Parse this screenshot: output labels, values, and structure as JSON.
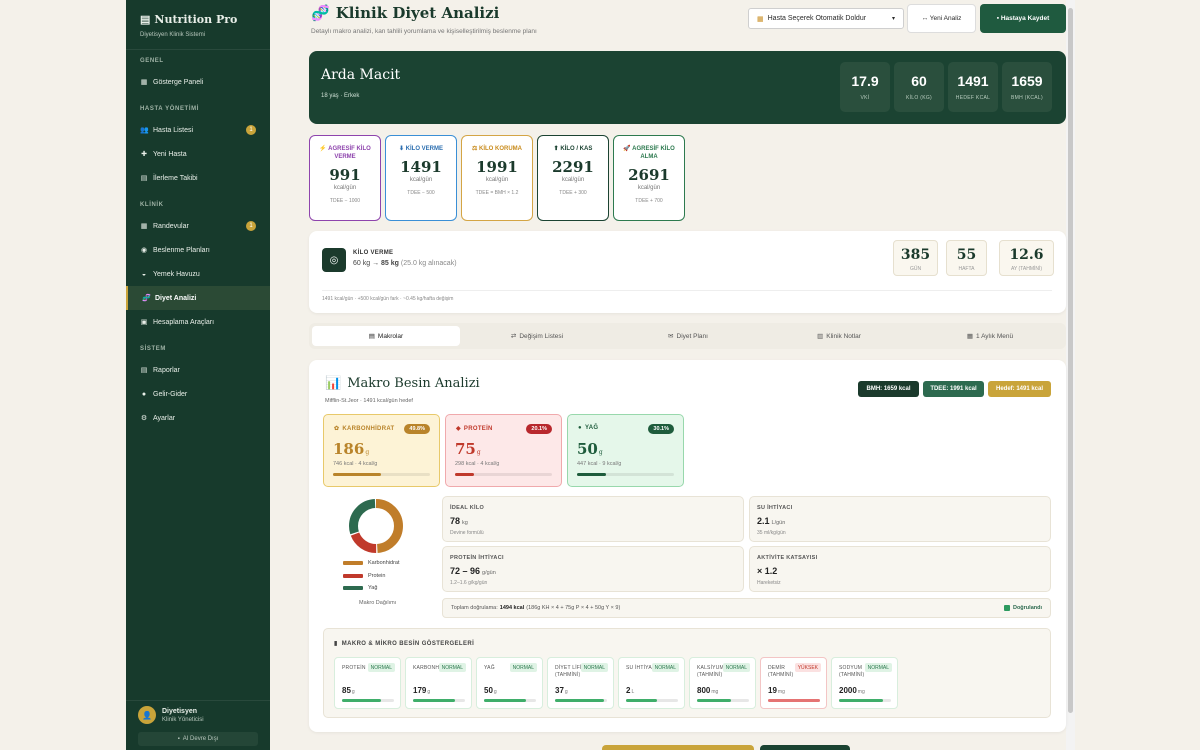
{
  "colors": {
    "sidebar_bg": "#173a2c",
    "accent_gold": "#c9a43a",
    "dark_green": "#1b4332",
    "page_bg": "#f4f1ea"
  },
  "sidebar": {
    "brand": "Nutrition Pro",
    "brand_icon": "document-icon",
    "subtitle": "Diyetisyen Klinik Sistemi",
    "sections": [
      {
        "title": "GENEL",
        "items": [
          {
            "label": "Gösterge Paneli",
            "icon": "dashboard-icon"
          }
        ]
      },
      {
        "title": "HASTA YÖNETİMİ",
        "items": [
          {
            "label": "Hasta Listesi",
            "icon": "users-icon",
            "badge": "1"
          },
          {
            "label": "Yeni Hasta",
            "icon": "plus-icon"
          },
          {
            "label": "İlerleme Takibi",
            "icon": "chart-icon"
          }
        ]
      },
      {
        "title": "KLİNİK",
        "items": [
          {
            "label": "Randevular",
            "icon": "calendar-icon",
            "badge": "1"
          },
          {
            "label": "Beslenme Planları",
            "icon": "plate-icon"
          },
          {
            "label": "Yemek Havuzu",
            "icon": "bowl-icon"
          },
          {
            "label": "Diyet Analizi",
            "icon": "dna-icon",
            "active": true
          },
          {
            "label": "Hesaplama Araçları",
            "icon": "calculator-icon"
          }
        ]
      },
      {
        "title": "SİSTEM",
        "items": [
          {
            "label": "Raporlar",
            "icon": "report-icon"
          },
          {
            "label": "Gelir-Gider",
            "icon": "money-icon"
          },
          {
            "label": "Ayarlar",
            "icon": "gear-icon"
          }
        ]
      }
    ],
    "user": {
      "name": "Diyetisyen",
      "role": "Klinik Yöneticisi"
    },
    "ai_button": "AI Devre Dışı"
  },
  "header": {
    "title": "Klinik Diyet Analizi",
    "subtitle": "Detaylı makro analizi, kan tahlili yorumlama ve kişiselleştirilmiş beslenme planı",
    "select_value": "Hasta Seçerek Otomatik Doldur",
    "new_button": "↔ Yeni Analiz",
    "save_button": "Hastaya Kaydet"
  },
  "patient": {
    "name": "Arda Macit",
    "meta": "18 yaş · Erkek",
    "stats": [
      {
        "value": "17.9",
        "label": "VKİ"
      },
      {
        "value": "60",
        "label": "KİLO (KG)"
      },
      {
        "value": "1491",
        "label": "HEDEF KCAL"
      },
      {
        "value": "1659",
        "label": "BMH (KCAL)"
      }
    ]
  },
  "goals": [
    {
      "name": "AGRESİF KİLO VERME",
      "icon": "lightning-icon",
      "value": "991",
      "unit": "kcal/gün",
      "formula": "TDEE − 1000",
      "color": "#8e44ad",
      "text_color": "#8e44ad"
    },
    {
      "name": "KİLO VERME",
      "icon": "arrow-down-icon",
      "value": "1491",
      "unit": "kcal/gün",
      "formula": "TDEE − 500",
      "color": "#3a8fd6",
      "text_color": "#2d6fb0"
    },
    {
      "name": "KİLO KORUMA",
      "icon": "balance-icon",
      "value": "1991",
      "unit": "kcal/gün",
      "formula": "TDEE = BMH × 1.2",
      "color": "#d4a545",
      "text_color": "#c98c1e"
    },
    {
      "name": "KİLO / KAS",
      "icon": "arrow-up-icon",
      "value": "2291",
      "unit": "kcal/gün",
      "formula": "TDEE + 300",
      "color": "#1b4332",
      "text_color": "#1b4332"
    },
    {
      "name": "AGRESİF KİLO ALMA",
      "icon": "rocket-icon",
      "value": "2691",
      "unit": "kcal/gün",
      "formula": "TDEE + 700",
      "color": "#2d7a4f",
      "text_color": "#2d7a4f"
    }
  ],
  "target": {
    "label": "KİLO VERME",
    "from": "60 kg",
    "arrow": "→",
    "to": "85 kg",
    "note": "(25.0 kg alınacak)",
    "boxes": [
      {
        "value": "385",
        "label": "GÜN"
      },
      {
        "value": "55",
        "label": "HAFTA"
      },
      {
        "value": "12.6",
        "label": "AY (TAHMİNİ)"
      }
    ],
    "footer": "1491 kcal/gün · +500 kcal/gün fark · ~0.45 kg/hafta değişim"
  },
  "tabs": [
    {
      "label": "Makrolar",
      "icon": "chart-icon",
      "active": true
    },
    {
      "label": "Değişim Listesi",
      "icon": "exchange-icon"
    },
    {
      "label": "Diyet Planı",
      "icon": "plan-icon"
    },
    {
      "label": "Klinik Notlar",
      "icon": "notes-icon"
    },
    {
      "label": "1 Aylık Menü",
      "icon": "calendar-icon"
    }
  ],
  "macro": {
    "title": "Makro Besin Analizi",
    "subtitle": "Mifflin-St.Jeor · 1491 kcal/gün hedef",
    "pills": [
      {
        "label": "BMH: 1659 kcal",
        "color": "#1b3a2c"
      },
      {
        "label": "TDEE: 1991 kcal",
        "color": "#2d6a4f"
      },
      {
        "label": "Hedef: 1491 kcal",
        "color": "#c9a43a"
      }
    ],
    "cards": [
      {
        "name": "KARBONHİDRAT",
        "icon": "wheat-icon",
        "pct": "49.8%",
        "value": "186",
        "unit": "g",
        "kcal": "746 kcal · 4 kcal/g",
        "fill": 0.498,
        "border": "#e8c96a",
        "bg": "#fdf3d6",
        "accent": "#b9842a",
        "badge": "#b9842a"
      },
      {
        "name": "PROTEİN",
        "icon": "meat-icon",
        "pct": "20.1%",
        "value": "75",
        "unit": "g",
        "kcal": "298 kcal · 4 kcal/g",
        "fill": 0.201,
        "border": "#f0a9ac",
        "bg": "#fde8e8",
        "accent": "#c0392b",
        "badge": "#b8282d"
      },
      {
        "name": "YAĞ",
        "icon": "olive-icon",
        "pct": "30.1%",
        "value": "50",
        "unit": "g",
        "kcal": "447 kcal · 9 kcal/g",
        "fill": 0.301,
        "border": "#98d8ac",
        "bg": "#e5f7ea",
        "accent": "#1e5c3c",
        "badge": "#1e5c3c"
      }
    ],
    "donut": {
      "caption": "Makro Dağılımı",
      "segments": [
        {
          "name": "Karbonhidrat",
          "value": 49.8,
          "color": "#c07d2a"
        },
        {
          "name": "Protein",
          "value": 20.1,
          "color": "#c0392b"
        },
        {
          "name": "Yağ",
          "value": 30.1,
          "color": "#2d6a4f"
        }
      ]
    },
    "info": [
      {
        "label": "İDEAL KİLO",
        "value": "78",
        "unit": "kg",
        "note": "Devine formülü"
      },
      {
        "label": "SU İHTİYACI",
        "value": "2.1",
        "unit": "L/gün",
        "note": "35 ml/kg/gün"
      },
      {
        "label": "PROTEİN İHTİYACI",
        "value": "72 – 96",
        "unit": "g/gün",
        "note": "1.2–1.6 g/kg/gün"
      },
      {
        "label": "AKTİVİTE KATSAYISI",
        "value": "× 1.2",
        "unit": "",
        "note": "Hareketsiz"
      }
    ],
    "verify": {
      "prefix": "Toplam doğrulama:",
      "total": "1494 kcal",
      "detail": "(186g KH × 4 + 75g P × 4 + 50g Y × 9)",
      "status": "Doğrulandı"
    },
    "indicators_title": "MAKRO & MİKRO BESİN GÖSTERGELERİ",
    "indicators": [
      {
        "name": "PROTEİN",
        "badge": "NORMAL",
        "value": "85",
        "unit": "g",
        "fill": 0.75,
        "status": "normal"
      },
      {
        "name": "KARBONHİDRAT",
        "badge": "NORMAL",
        "value": "179",
        "unit": "g",
        "fill": 0.8,
        "status": "normal"
      },
      {
        "name": "YAĞ",
        "badge": "NORMAL",
        "value": "50",
        "unit": "g",
        "fill": 0.8,
        "status": "normal"
      },
      {
        "name": "DİYET LİFİ (TAHMİNİ)",
        "badge": "NORMAL",
        "value": "37",
        "unit": "g",
        "fill": 0.95,
        "status": "normal"
      },
      {
        "name": "SU İHTİYACI",
        "badge": "NORMAL",
        "value": "2",
        "unit": "L",
        "fill": 0.6,
        "status": "normal"
      },
      {
        "name": "KALSİYUM (TAHMİNİ)",
        "badge": "NORMAL",
        "value": "800",
        "unit": "mg",
        "fill": 0.65,
        "status": "normal"
      },
      {
        "name": "DEMİR (TAHMİNİ)",
        "badge": "YÜKSEK",
        "value": "19",
        "unit": "mg",
        "fill": 1.0,
        "status": "high"
      },
      {
        "name": "SODYUM (TAHMİNİ)",
        "badge": "NORMAL",
        "value": "2000",
        "unit": "mg",
        "fill": 0.85,
        "status": "normal"
      }
    ]
  }
}
